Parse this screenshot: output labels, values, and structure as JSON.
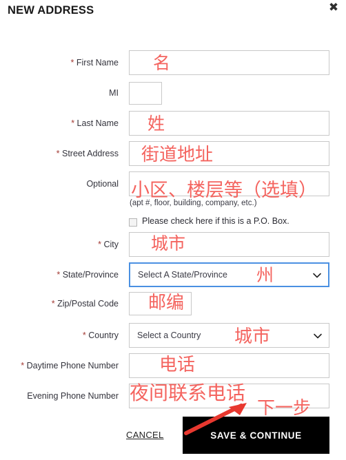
{
  "dialog": {
    "title": "NEW ADDRESS",
    "close_icon": "close-icon",
    "close_glyph": "✖"
  },
  "form": {
    "fields": [
      {
        "name": "first-name",
        "label": "First Name",
        "required": true,
        "required_mark": "*",
        "type": "text",
        "value": "",
        "annotation": "名"
      },
      {
        "name": "mi",
        "label": "MI",
        "required": false,
        "required_mark": "",
        "type": "text",
        "value": "",
        "annotation": ""
      },
      {
        "name": "last-name",
        "label": "Last Name",
        "required": true,
        "required_mark": "*",
        "type": "text",
        "value": "",
        "annotation": "姓"
      },
      {
        "name": "street-address",
        "label": "Street Address",
        "required": true,
        "required_mark": "*",
        "type": "text",
        "value": "",
        "annotation": "街道地址"
      },
      {
        "name": "optional-address",
        "label": "Optional",
        "required": false,
        "required_mark": "",
        "type": "text",
        "value": "",
        "hint": "(apt #, floor, building, company, etc.)",
        "annotation": "小区、楼层等（选填）"
      },
      {
        "name": "city",
        "label": "City",
        "required": true,
        "required_mark": "*",
        "type": "text",
        "value": "",
        "annotation": "城市"
      },
      {
        "name": "state-province",
        "label": "State/Province",
        "required": true,
        "required_mark": "*",
        "type": "select",
        "value": "Select A State/Province",
        "focused": true,
        "annotation": "州"
      },
      {
        "name": "zip-postal-code",
        "label": "Zip/Postal Code",
        "required": true,
        "required_mark": "*",
        "type": "text",
        "value": "",
        "annotation": "邮编"
      },
      {
        "name": "country",
        "label": "Country",
        "required": true,
        "required_mark": "*",
        "type": "select",
        "value": "Select a Country",
        "focused": false,
        "annotation": "城市"
      },
      {
        "name": "daytime-phone-number",
        "label": "Daytime Phone Number",
        "required": true,
        "required_mark": "*",
        "type": "text",
        "value": "",
        "annotation": "电话"
      },
      {
        "name": "evening-phone-number",
        "label": "Evening Phone Number",
        "required": false,
        "required_mark": "",
        "type": "text",
        "value": "",
        "annotation": "夜间联系电话"
      }
    ],
    "po_box_checkbox": {
      "label": "Please check here if this is a P.O. Box.",
      "checked": false
    }
  },
  "footer": {
    "cancel_label": "CANCEL",
    "save_label": "SAVE & CONTINUE",
    "save_annotation": "下一步"
  },
  "colors": {
    "annotation_red": "#f4645f",
    "required_star": "#a33a34",
    "focus_blue": "#4a90e2",
    "button_black": "#000000",
    "field_border": "#c8c8c8"
  }
}
